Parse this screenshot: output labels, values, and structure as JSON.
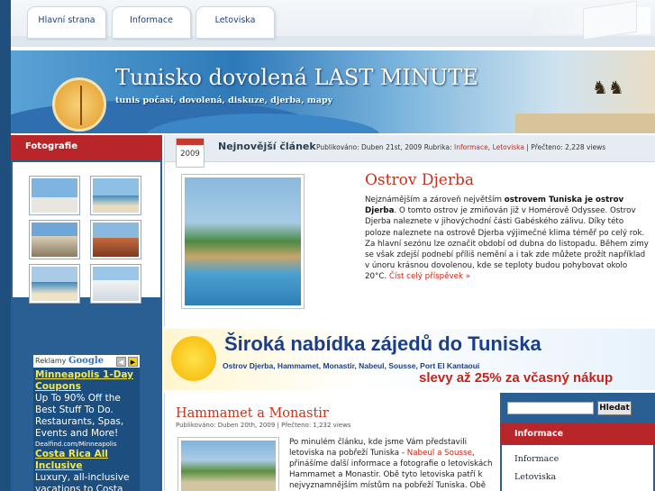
{
  "nav": {
    "tabs": [
      "Hlavní strana",
      "Informace",
      "Letoviska"
    ]
  },
  "header": {
    "title": "Tunisko dovolená LAST MINUTE",
    "subtitle": "tunis počasí, dovolená, diskuze, djerba, mapy"
  },
  "left": {
    "photos_title": "Fotografie",
    "ad": {
      "label": "Reklamy",
      "brand": "Google",
      "items": [
        {
          "title": "Minneapolis 1-Day Coupons",
          "text": "Up To 90% Off the Best Stuff To Do. Restaurants, Spas, Events and More!",
          "url": "Dealfind.com/Minneapolis"
        },
        {
          "title": "Costa Rica All Inclusive",
          "text": "Luxury, all-inclusive vacations to Costa",
          "url": ""
        }
      ]
    }
  },
  "featured": {
    "header_title": "Nejnovější článek",
    "year": "2009",
    "published": "Publikováno: Duben 21st, 2009",
    "rubric_label": "Rubrika:",
    "rubric_1": "Informace",
    "rubric_2": "Letoviska",
    "read": "Přečteno: 2,228 views",
    "title": "Ostrov Djerba",
    "text_1": "Nejznámějším a zároveň největším ",
    "text_bold": "ostrovem Tuniska je ostrov Djerba",
    "text_2": ". O tomto ostrov je zmiňován již v Homérově Odyssee. Ostrov Djerba naleznete v jihovýchodní části Gabéského zálivu. Díky této poloze naleznete na ostrově Djerba výjimečné klima téměř po celý rok. Za hlavní sezónu lze označit období od dubna do listopadu. Během zimy se však zdejší podnebí příliš nemění a i tak zde můžete prožít například v únoru krásnou dovolenou, kde se teploty budou pohybovat okolo 20°C. ",
    "more": "Číst celý příspěvek »"
  },
  "promo": {
    "headline": "Široká nabídka zájedů do Tuniska",
    "places": "Ostrov Djerba, Hammamet, Monastir, Nabeul, Sousse, Port El Kantaoui",
    "discount": "slevy až 25% za včasný nákup"
  },
  "article2": {
    "title": "Hammamet a Monastir",
    "meta": "Publikováno: Duben 20th, 2009 | Přečteno: 1,232 views",
    "text_1": "Po minulém článku, kde jsme Vám představili letoviska na pobřeží Tuniska - ",
    "link": "Nabeul a Sousse",
    "text_2": ", přinášíme další informace a fotografie o letoviskách Hammamet a Monastir. Obě tyto letoviska patří k nejvyznamnějším místům na pobřeží Tuniska. Obě"
  },
  "right": {
    "search_button": "Hledat",
    "section_title": "Informace",
    "items": [
      "Informace",
      "Letoviska"
    ]
  }
}
